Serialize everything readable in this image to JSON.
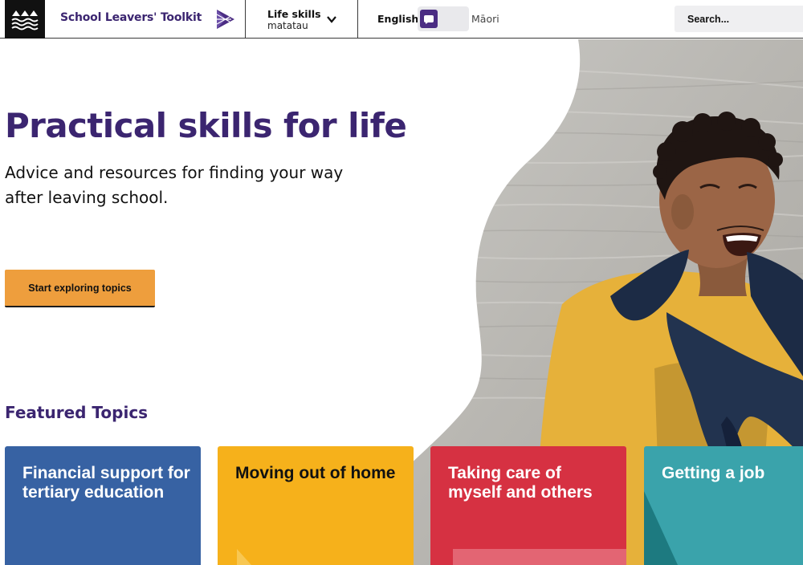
{
  "header": {
    "site_title": "School Leavers' Toolkit",
    "nav": {
      "title": "Life skills",
      "subtitle": "matatau"
    },
    "language": {
      "english": "English",
      "maori": "Māori",
      "selected": "English"
    },
    "search": {
      "placeholder": "Search...",
      "value": ""
    }
  },
  "hero": {
    "title": "Practical skills for life",
    "subtitle": "Advice and resources for finding your way after leaving school.",
    "cta_label": "Start exploring topics"
  },
  "featured": {
    "heading": "Featured Topics",
    "cards": [
      {
        "title": "Financial support for tertiary education",
        "color": "#3762a3"
      },
      {
        "title": "Moving out of home",
        "color": "#f6b11b"
      },
      {
        "title": "Taking care of myself and others",
        "color": "#d63142"
      },
      {
        "title": "Getting a job",
        "color": "#3aa3ab"
      }
    ]
  },
  "colors": {
    "brand_purple": "#3b2570",
    "toggle_purple": "#4b2d83",
    "cta_orange": "#ee9e3d"
  },
  "icons": [
    "logo-waves-icon",
    "triangle-arrow-icon",
    "chevron-down-icon",
    "speech-bubble-icon"
  ]
}
